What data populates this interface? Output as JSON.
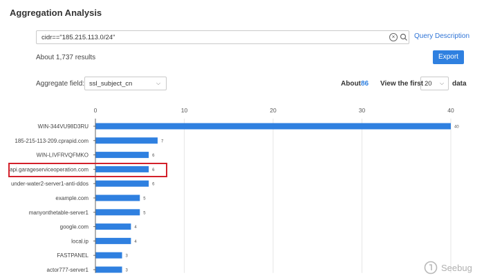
{
  "page": {
    "title": "Aggregation Analysis",
    "search": {
      "value": "cidr==\"185.215.113.0/24\""
    },
    "query_description": "Query Description",
    "results": "About 1,737 results",
    "export_label": "Export",
    "aggregate_field_label": "Aggregate field:",
    "aggregate_field_value": "ssl_subject_cn",
    "about_label": "About",
    "about_count": "86",
    "view_first_label": "View the first",
    "view_first_value": "20",
    "data_label": "data",
    "watermark": "Seebug"
  },
  "icons": {
    "clear": "clear-circle-icon",
    "search": "search-icon",
    "dropdown": "chevron-down-icon",
    "watermark": "seebug-logo-icon"
  },
  "colors": {
    "bar": "#2f80e0",
    "highlight": "#d3202a",
    "accent": "#2f80e0"
  },
  "chart_data": {
    "type": "bar",
    "orientation": "horizontal",
    "categories": [
      "WIN-344VU98D3RU",
      "185-215-113-209.cprapid.com",
      "WIN-LIVFRVQFMKO",
      "api.garageserviceoperation.com",
      "under-water2-server1-anti-ddos",
      "example.com",
      "manyonthetable-server1",
      "google.com",
      "local.ip",
      "FASTPANEL",
      "actor777-server1"
    ],
    "values": [
      40,
      7,
      6,
      6,
      6,
      5,
      5,
      4,
      4,
      3,
      3
    ],
    "xlim": [
      0,
      40
    ],
    "xticks": [
      "0",
      "10",
      "20",
      "30",
      "40"
    ],
    "grid": true,
    "highlighted_category": "api.garageserviceoperation.com"
  }
}
